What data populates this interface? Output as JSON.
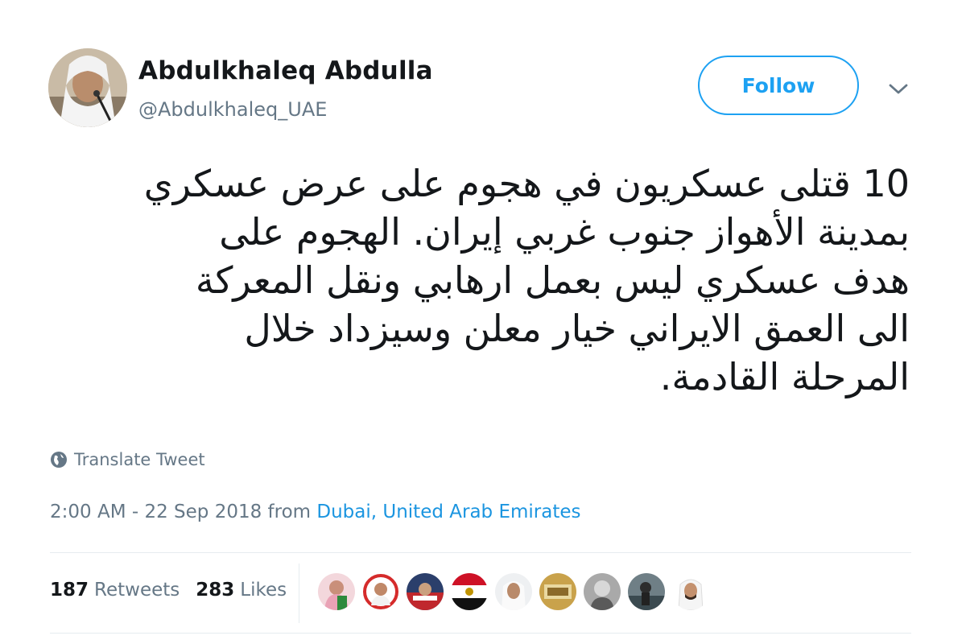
{
  "author": {
    "name": "Abdulkhaleq Abdulla",
    "handle": "@Abdulkhaleq_UAE"
  },
  "follow_label": "Follow",
  "caret_icon": "chevron-down-icon",
  "tweet": {
    "lines": [
      "10 قتلى عسكريون في هجوم على عرض عسكري",
      "بمدينة الأهواز جنوب غربي إيران. الهجوم على",
      "هدف عسكري ليس بعمل ارهابي ونقل المعركة",
      "الى العمق الايراني خيار معلن وسيزداد خلال",
      "المرحلة القادمة."
    ]
  },
  "translate_label": "Translate Tweet",
  "timestamp": "2:00 AM - 22 Sep 2018",
  "from_word": "from",
  "location": "Dubai, United Arab Emirates",
  "stats": {
    "retweets_count": "187",
    "retweets_label": "Retweets",
    "likes_count": "283",
    "likes_label": "Likes"
  },
  "colors": {
    "accent": "#1da1f2",
    "link": "#1b95e0",
    "muted": "#657786",
    "text": "#14171a"
  }
}
